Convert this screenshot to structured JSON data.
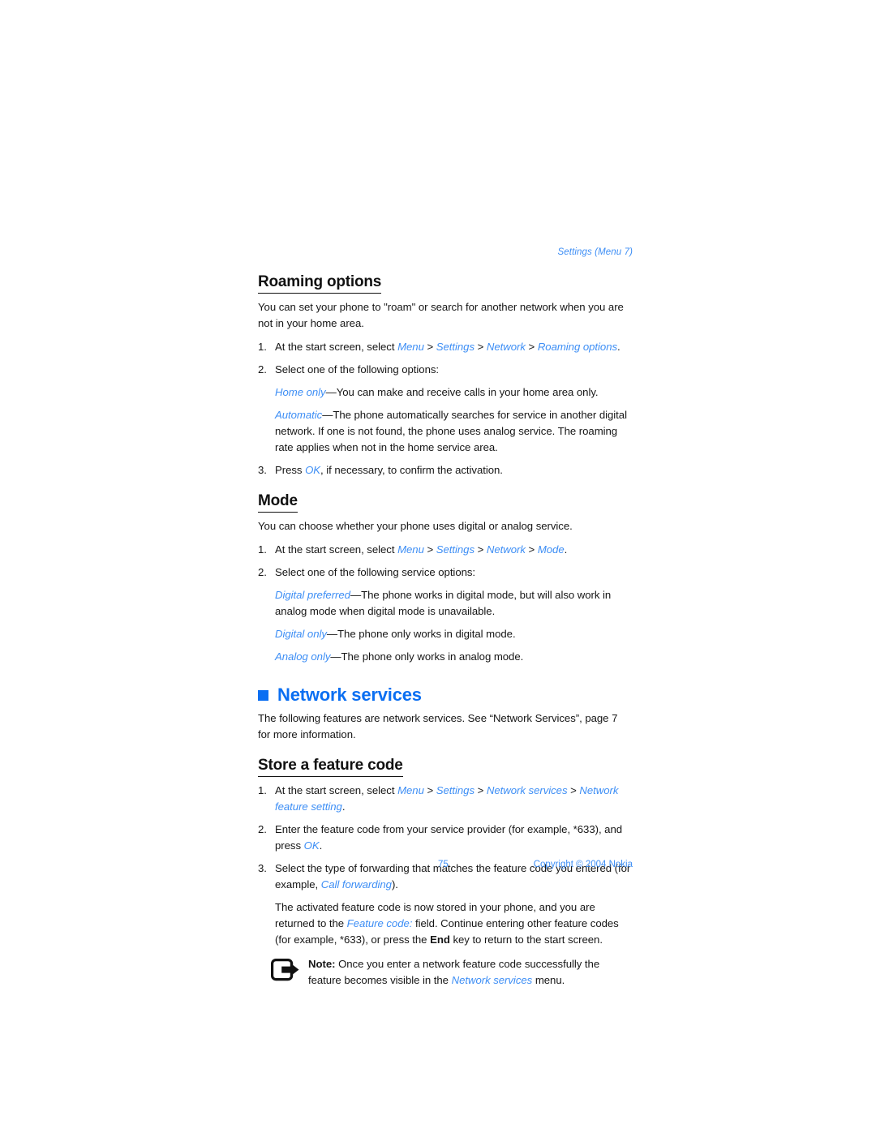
{
  "running_head": "Settings (Menu 7)",
  "sections": [
    {
      "heading": "Roaming options",
      "intro": "You can set your phone to \"roam\" or search for another network when you are not in your home area.",
      "steps": [
        {
          "num": "1.",
          "prefix": "At the start screen, select ",
          "path": [
            "Menu",
            "Settings",
            "Network",
            "Roaming options"
          ],
          "suffix": "."
        },
        {
          "num": "2.",
          "prefix": "Select one of the following options:",
          "path": [],
          "suffix": ""
        },
        {
          "num": "3.",
          "prefix": "Press ",
          "path": [
            "OK"
          ],
          "suffix": ", if necessary, to confirm the activation."
        }
      ],
      "options": [
        {
          "term": "Home only",
          "dash": "—",
          "desc": "You can make and receive calls in your home area only."
        },
        {
          "term": "Automatic",
          "dash": "—",
          "desc": "The phone automatically searches for service in another digital network. If one is not found, the phone uses analog service. The roaming rate applies when not in the home service area."
        }
      ]
    },
    {
      "heading": "Mode",
      "intro": "You can choose whether your phone uses digital or analog service.",
      "steps": [
        {
          "num": "1.",
          "prefix": "At the start screen, select ",
          "path": [
            "Menu",
            "Settings",
            "Network",
            "Mode"
          ],
          "suffix": "."
        },
        {
          "num": "2.",
          "prefix": "Select one of the following service options:",
          "path": [],
          "suffix": ""
        }
      ],
      "options": [
        {
          "term": "Digital preferred",
          "dash": "—",
          "desc": "The phone works in digital mode, but will also work in analog mode when digital mode is unavailable."
        },
        {
          "term": "Digital only",
          "dash": "—",
          "desc": "The phone only works in digital mode."
        },
        {
          "term": "Analog only",
          "dash": "—",
          "desc": "The phone only works in analog mode."
        }
      ]
    }
  ],
  "chapter": {
    "title": "Network services",
    "bullet_color": "#0b6ff2",
    "intro": "The following features are network services. See “Network Services”, page 7 for more information."
  },
  "feature_code": {
    "heading": "Store a feature code",
    "step1": {
      "num": "1.",
      "prefix": "At the start screen, select ",
      "path": [
        "Menu",
        "Settings",
        "Network services",
        "Network feature setting"
      ],
      "suffix": "."
    },
    "step2": {
      "num": "2.",
      "prefix": "Enter the feature code from your service provider (for example, *633), and press ",
      "link": "OK",
      "suffix": "."
    },
    "step3": {
      "num": "3.",
      "line1": "Select the type of forwarding that matches the feature code you entered (for example, ",
      "link": "Call forwarding",
      "suffix": ")."
    },
    "paragraph": {
      "part1": "The activated feature code is now stored in your phone, and you are returned to the ",
      "link1": "Feature code:",
      "part2": " field. Continue entering other feature codes (for example, *633), or press the ",
      "bold1": "End",
      "part3": " key to return to the start screen."
    }
  },
  "note": {
    "icon": "note-arrow-icon",
    "label": "Note:",
    "part1": " Once you enter a network feature code successfully the feature becomes visible in the ",
    "link": "Network services",
    "part2": " menu."
  },
  "footer": {
    "page_number": "75",
    "copyright": "Copyright © 2004 Nokia"
  },
  "colors": {
    "link_blue": "#3d8ef5",
    "chapter_blue": "#0b6ff2",
    "text": "#161616"
  }
}
